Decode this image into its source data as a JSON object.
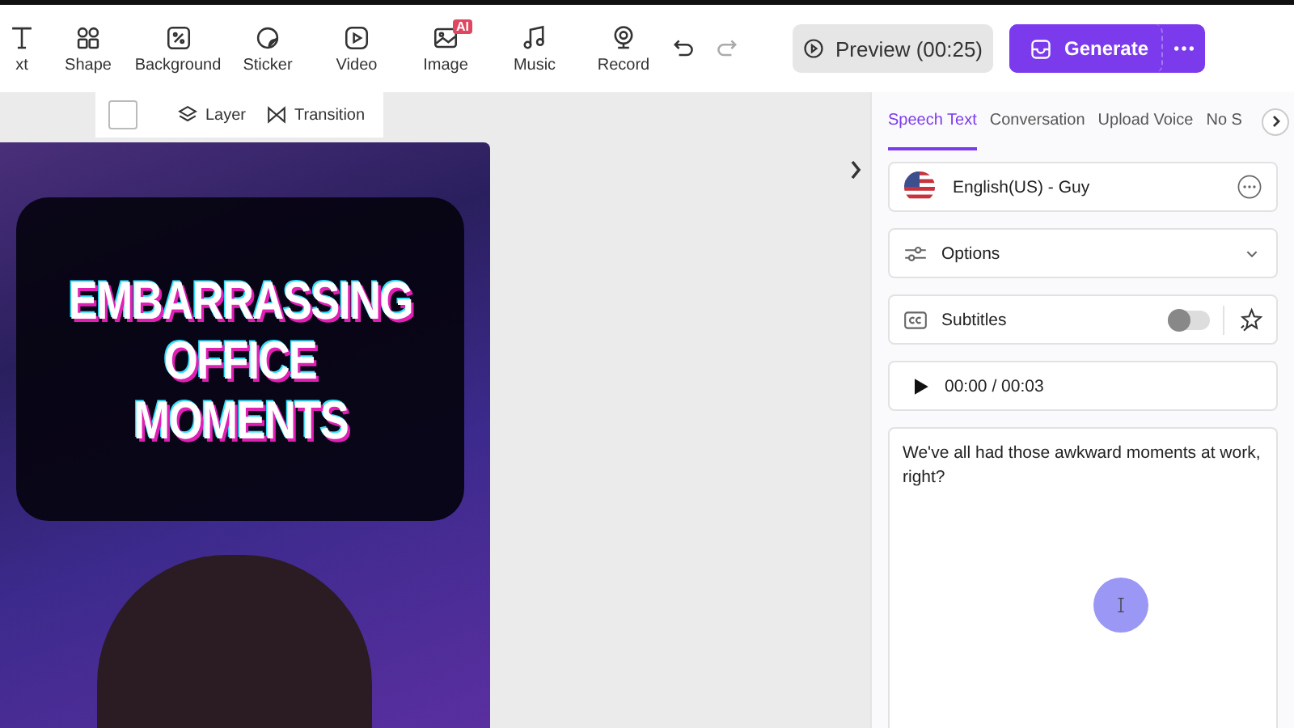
{
  "toolbar": {
    "tools": [
      {
        "label": "xt"
      },
      {
        "label": "Shape"
      },
      {
        "label": "Background"
      },
      {
        "label": "Sticker"
      },
      {
        "label": "Video"
      },
      {
        "label": "Image",
        "badge": "AI"
      },
      {
        "label": "Music"
      },
      {
        "label": "Record"
      }
    ],
    "preview": {
      "label": "Preview (00:25)"
    },
    "generate": {
      "label": "Generate"
    }
  },
  "canvas_toolbar": {
    "items": [
      "Layer",
      "Transition"
    ]
  },
  "canvas": {
    "title_lines": [
      "EMBARRASSING",
      "OFFICE",
      "MOMENTS"
    ]
  },
  "panel": {
    "tabs": [
      {
        "label": "Speech Text",
        "selected": true
      },
      {
        "label": "Conversation",
        "selected": false
      },
      {
        "label": "Upload Voice",
        "selected": false
      },
      {
        "label": "No S",
        "selected": false
      }
    ],
    "voice": "English(US) - Guy",
    "options": "Options",
    "subtitles": {
      "label": "Subtitles",
      "on": false
    },
    "player": {
      "time": "00:00 / 00:03"
    },
    "script": "We've all had those awkward moments at work, right?"
  }
}
